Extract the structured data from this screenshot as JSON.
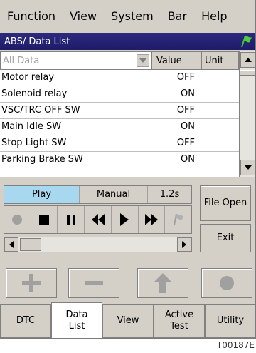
{
  "menu": {
    "items": [
      "Function",
      "View",
      "System",
      "Bar",
      "Help"
    ]
  },
  "title": {
    "text": "ABS/ Data List",
    "flag_icon": "green-flag-icon"
  },
  "list": {
    "filter_value": "All Data",
    "columns": {
      "value": "Value",
      "unit": "Unit"
    },
    "rows": [
      {
        "name": "Motor relay",
        "value": "OFF",
        "unit": ""
      },
      {
        "name": "Solenoid relay",
        "value": "ON",
        "unit": ""
      },
      {
        "name": "VSC/TRC OFF SW",
        "value": "OFF",
        "unit": ""
      },
      {
        "name": "Main Idle SW",
        "value": "ON",
        "unit": ""
      },
      {
        "name": "Stop Light SW",
        "value": "OFF",
        "unit": ""
      },
      {
        "name": "Parking Brake SW",
        "value": "ON",
        "unit": ""
      }
    ]
  },
  "player": {
    "play_label": "Play",
    "manual_label": "Manual",
    "speed_label": "1.2s",
    "file_open_label": "File Open",
    "exit_label": "Exit"
  },
  "tabs": {
    "dtc": "DTC",
    "data_list_line1": "Data",
    "data_list_line2": "List",
    "view": "View",
    "active_test_line1": "Active",
    "active_test_line2": "Test",
    "utility": "Utility"
  },
  "caption": "T00187E",
  "colors": {
    "title_bg": "#1e1b6a",
    "play_highlight": "#a8d8f0",
    "panel": "#d4d0c8"
  }
}
